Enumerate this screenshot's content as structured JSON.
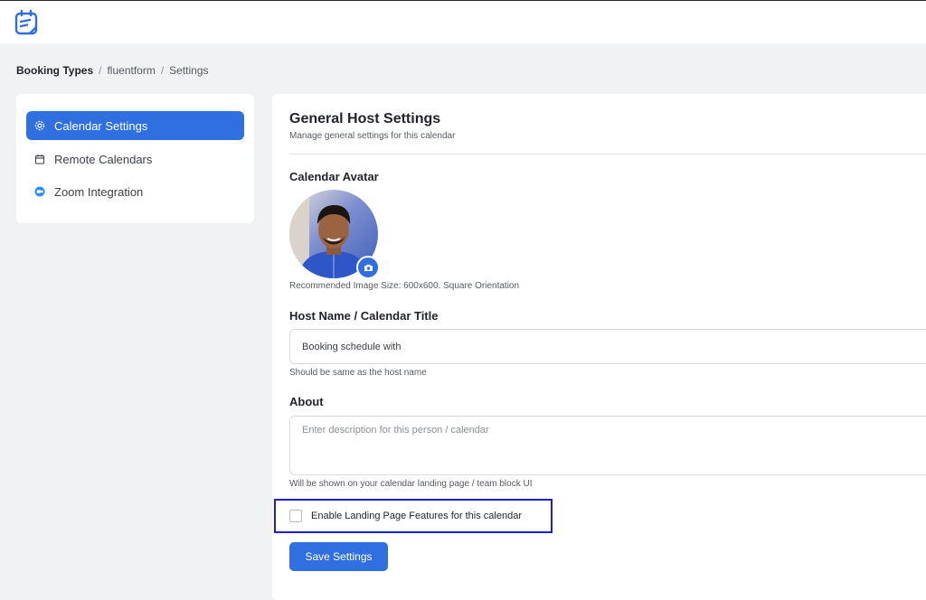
{
  "breadcrumb": {
    "item1": "Booking Types",
    "item2": "fluentform",
    "item3": "Settings",
    "separator": "/"
  },
  "sidebar": {
    "items": [
      {
        "label": "Calendar Settings",
        "icon": "gear-icon",
        "active": true
      },
      {
        "label": "Remote Calendars",
        "icon": "calendar-icon",
        "active": false
      },
      {
        "label": "Zoom Integration",
        "icon": "zoom-icon",
        "active": false
      }
    ]
  },
  "main": {
    "title": "General Host Settings",
    "subtitle": "Manage general settings for this calendar",
    "avatar_label": "Calendar Avatar",
    "avatar_help": "Recommended Image Size: 600x600. Square Orientation",
    "host_label": "Host Name / Calendar Title",
    "host_value": "Booking schedule with",
    "host_help": "Should be same as the host name",
    "about_label": "About",
    "about_placeholder": "Enter description for this person / calendar",
    "about_help": "Will be shown on your calendar landing page / team block UI",
    "landing_checkbox_label": "Enable Landing Page Features for this calendar",
    "landing_checked": false,
    "save_label": "Save Settings"
  },
  "colors": {
    "accent": "#2f6fdf",
    "highlight_border": "#1d1de0",
    "page_bg": "#f1f2f4"
  }
}
